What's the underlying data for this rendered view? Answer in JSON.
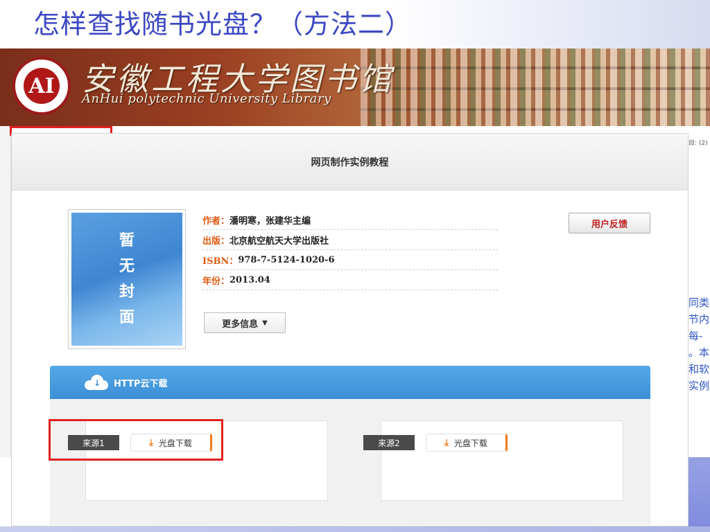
{
  "slide": {
    "title": "怎样查找随书光盘？（方法二）"
  },
  "banner": {
    "logo_text": "AI",
    "name_cn": "安徽工程大学图书馆",
    "name_en": "AnHui polytechnic University Library"
  },
  "background_page": {
    "right_snippet_top": "目:\n(2)",
    "right_snippet_lines": [
      "同类",
      "节内",
      " 每-",
      "。本",
      "和软",
      "实例"
    ]
  },
  "card": {
    "title": "网页制作实例教程",
    "cover_chars": [
      "暂",
      "无",
      "封",
      "面"
    ],
    "info": [
      {
        "key": "作者：",
        "value": "潘明寒，张建华主编"
      },
      {
        "key": "出版：",
        "value": "北京航空航天大学出版社"
      },
      {
        "key": "ISBN：",
        "value": "978-7-5124-1020-6"
      },
      {
        "key": "年份：",
        "value": "2013.04"
      }
    ],
    "more_button": "更多信息",
    "feedback_button": "用户反馈",
    "download": {
      "bar_label": "HTTP云下载",
      "sources": [
        {
          "tag": "来源1",
          "button": "光盘下载"
        },
        {
          "tag": "来源2",
          "button": "光盘下载"
        }
      ]
    }
  },
  "colors": {
    "title": "#3c48c4",
    "accent_orange": "#f07a1a",
    "highlight_red": "#e02020",
    "download_bar": "#3c8fd6"
  }
}
